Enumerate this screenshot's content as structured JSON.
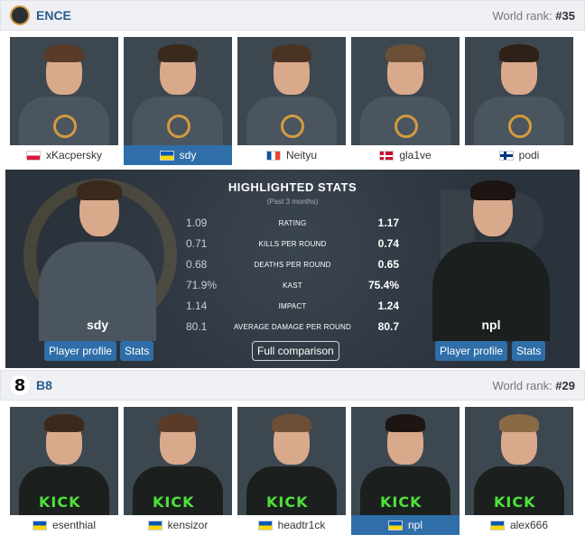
{
  "team1": {
    "name": "ENCE",
    "rank_label": "World rank: ",
    "rank": "#35",
    "players": [
      {
        "nick": "xKacpersky",
        "flag": "pl",
        "active": false,
        "hair": "#5a3b28"
      },
      {
        "nick": "sdy",
        "flag": "ua",
        "active": true,
        "hair": "#3a2a1c"
      },
      {
        "nick": "Neityu",
        "flag": "fr",
        "active": false,
        "hair": "#4a3322"
      },
      {
        "nick": "gla1ve",
        "flag": "dk",
        "active": false,
        "hair": "#6b4f36"
      },
      {
        "nick": "podi",
        "flag": "fi",
        "active": false,
        "hair": "#2e2118"
      }
    ]
  },
  "team2": {
    "name": "B8",
    "rank_label": "World rank: ",
    "rank": "#29",
    "players": [
      {
        "nick": "esenthial",
        "flag": "ua",
        "active": false,
        "hair": "#3a2a1c"
      },
      {
        "nick": "kensizor",
        "flag": "ua",
        "active": false,
        "hair": "#5a3b28"
      },
      {
        "nick": "headtr1ck",
        "flag": "ua",
        "active": false,
        "hair": "#6b4f36"
      },
      {
        "nick": "npl",
        "flag": "ua",
        "active": true,
        "hair": "#1c1512"
      },
      {
        "nick": "alex666",
        "flag": "ua",
        "active": false,
        "hair": "#8a6a45"
      }
    ]
  },
  "highlighted": {
    "title": "HIGHLIGHTED STATS",
    "subtitle": "(Past 3 months)",
    "left_player": "sdy",
    "right_player": "npl",
    "rows": [
      {
        "left": "1.09",
        "name": "RATING",
        "right": "1.17"
      },
      {
        "left": "0.71",
        "name": "KILLS PER ROUND",
        "right": "0.74"
      },
      {
        "left": "0.68",
        "name": "DEATHS PER ROUND",
        "right": "0.65"
      },
      {
        "left": "71.9%",
        "name": "KAST",
        "right": "75.4%"
      },
      {
        "left": "1.14",
        "name": "IMPACT",
        "right": "1.24"
      },
      {
        "left": "80.1",
        "name": "AVERAGE DAMAGE PER ROUND",
        "right": "80.7"
      }
    ],
    "profile_label": "Player profile",
    "stats_label": "Stats",
    "comparison_label": "Full comparison"
  }
}
